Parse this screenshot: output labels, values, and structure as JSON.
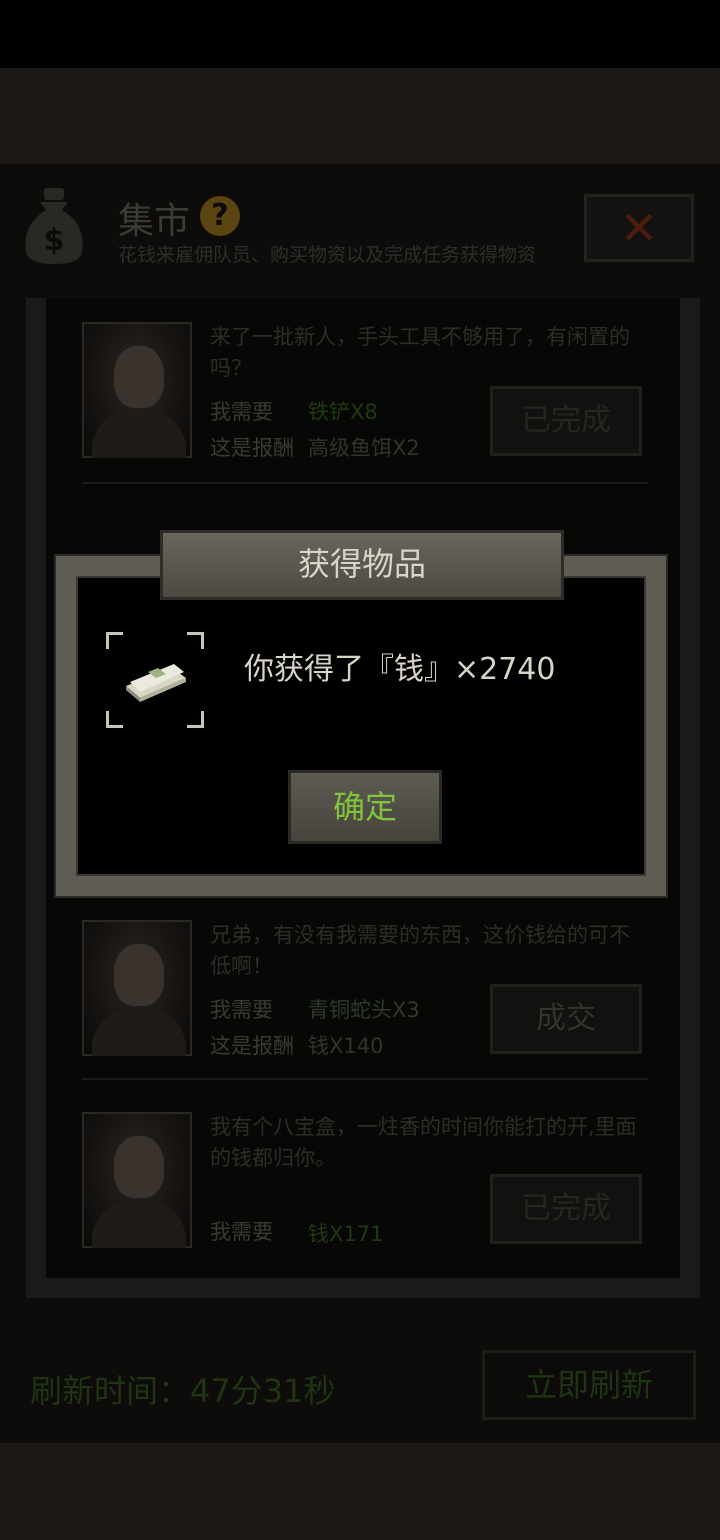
{
  "market": {
    "title": "集市",
    "help_icon": "?",
    "subtitle": "花钱来雇佣队员、购买物资以及完成任务获得物资",
    "close_icon": "✕",
    "tasks": [
      {
        "description": "来了一批新人，手头工具不够用了，有闲置的吗？",
        "need_label": "我需要",
        "need_value": "铁铲X8",
        "reward_label": "这是报酬",
        "reward_value": "高级鱼饵X2",
        "button": "已完成"
      },
      {
        "description": "兄弟，有没有我需要的东西，这价钱给的可不低啊！",
        "need_label": "我需要",
        "need_value": "青铜蛇头X3",
        "reward_label": "这是报酬",
        "reward_value": "钱X140",
        "button": "成交"
      },
      {
        "description": "我有个八宝盒，一炷香的时间你能打的开,里面的钱都归你。",
        "need_label": "我需要",
        "need_value": "钱X171",
        "button": "已完成"
      }
    ],
    "refresh_label": "刷新时间：47分31秒",
    "refresh_button": "立即刷新"
  },
  "dialog": {
    "title": "获得物品",
    "item_icon": "money-stack-icon",
    "message": "你获得了『钱』×2740",
    "confirm_button": "确定"
  },
  "colors": {
    "confirm_text": "#7fc43a",
    "dialog_frame": "#5f5c53"
  }
}
